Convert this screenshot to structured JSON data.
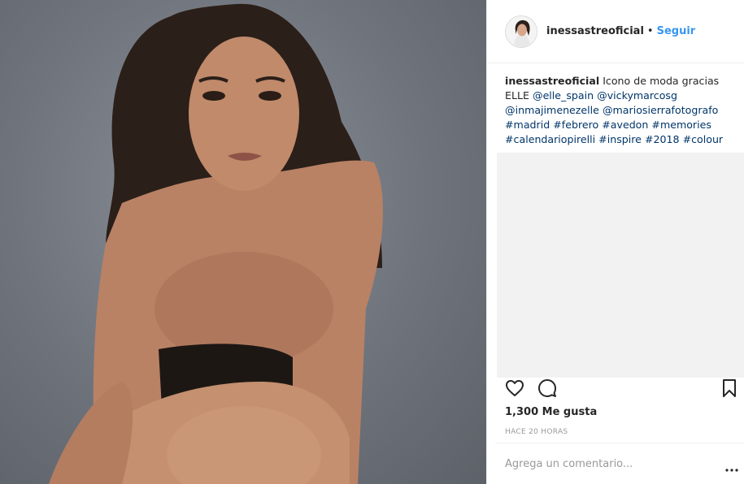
{
  "post": {
    "image_alt": "Portrait photo of a woman with long dark hair on a grey background",
    "header": {
      "username": "inessastreoficial",
      "separator": "•",
      "follow_label": "Seguir"
    },
    "caption": {
      "username": "inessastreoficial",
      "text_intro": "Icono de moda gracias ELLE",
      "mentions": [
        "@elle_spain",
        "@vickymarcosg",
        "@inmajimenezelle",
        "@mariosierrafotografo"
      ],
      "hashtags": [
        "#madrid",
        "#febrero",
        "#avedon",
        "#memories",
        "#calendariopirelli",
        "#inspire",
        "#2018",
        "#colour"
      ]
    },
    "actions": {
      "like_icon": "heart-icon",
      "comment_icon": "comment-icon",
      "save_icon": "bookmark-icon"
    },
    "likes_text": "1,300 Me gusta",
    "timestamp": "HACE 20 HORAS",
    "add_comment": {
      "placeholder": "Agrega un comentario...",
      "more_icon": "more-options-icon"
    }
  }
}
